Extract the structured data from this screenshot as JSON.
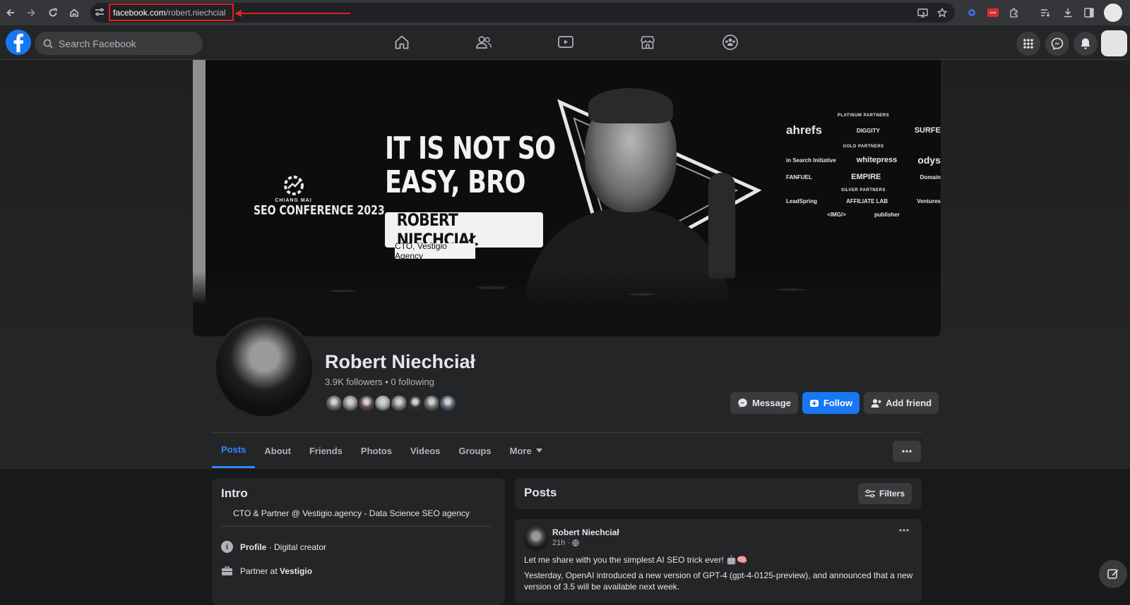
{
  "browser": {
    "url_host": "facebook.com",
    "url_path": "/robert.niechcial"
  },
  "fb": {
    "search_placeholder": "Search Facebook"
  },
  "cover": {
    "title": "IT IS NOT SO EASY, BRO",
    "speaker_name": "ROBERT NIECHCIAŁ",
    "speaker_role": "CTO, Vestigio Agency",
    "conference_city": "CHIANG MAI",
    "conference_name": "SEO CONFERENCE 2023",
    "sponsors": {
      "platinum_heading": "PLATINUM PARTNERS",
      "platinum": [
        "ahrefs",
        "DIGGITY",
        "SURFE"
      ],
      "gold_heading": "GOLD PARTNERS",
      "gold_row1": [
        "in Search Initiative",
        "whitepress",
        "odys"
      ],
      "gold_row2": [
        "FANFUEL",
        "EMPIRE",
        "Domain"
      ],
      "silver_heading": "SILVER PARTNERS",
      "silver_row1": [
        "LeadSpring",
        "AFFILIATE LAB",
        "Ventures"
      ],
      "silver_row2": [
        "<IMG/>",
        "publisher"
      ]
    }
  },
  "profile": {
    "name": "Robert Niechciał",
    "stats": "3.9K followers • 0 following",
    "buttons": {
      "message": "Message",
      "follow": "Follow",
      "add_friend": "Add friend"
    },
    "friend_face_colors": [
      "#6b6b6b",
      "#8a8a8a",
      "#5c4a3e",
      "#a0a0a0",
      "#7a7a7a",
      "#2b2b2b",
      "#686868",
      "#566273"
    ]
  },
  "tabs": [
    {
      "label": "Posts",
      "active": true
    },
    {
      "label": "About"
    },
    {
      "label": "Friends"
    },
    {
      "label": "Photos"
    },
    {
      "label": "Videos"
    },
    {
      "label": "Groups"
    },
    {
      "label": "More"
    }
  ],
  "intro": {
    "title": "Intro",
    "bio": "CTO & Partner @ Vestigio.agency - Data Science SEO agency",
    "profile_label": "Profile",
    "profile_value": " · Digital creator",
    "work_prefix": "Partner at ",
    "work_company": "Vestigio"
  },
  "posts": {
    "title": "Posts",
    "filters_label": "Filters",
    "post": {
      "author": "Robert Niechciał",
      "time": "21h ·",
      "line1": "Let me share with you the simplest AI SEO trick ever! 🤖🧠",
      "line2": "Yesterday, OpenAI introduced a new version of GPT-4 (gpt-4-0125-preview), and announced that a new",
      "line3": "version of 3.5 will be available next week."
    }
  },
  "colors": {
    "accent": "#1877f2",
    "background": "#18191a",
    "surface": "#242526",
    "annotation": "#e02020"
  },
  "icons": [
    "back-icon",
    "forward-icon",
    "reload-icon",
    "home-icon",
    "site-settings-icon",
    "cast-icon",
    "star-icon",
    "extension-icon",
    "download-icon",
    "facebook-logo-icon",
    "search-icon",
    "home-nav-icon",
    "friends-nav-icon",
    "watch-nav-icon",
    "marketplace-nav-icon",
    "groups-nav-icon",
    "menu-grid-icon",
    "messenger-icon",
    "bell-icon",
    "compose-icon"
  ]
}
